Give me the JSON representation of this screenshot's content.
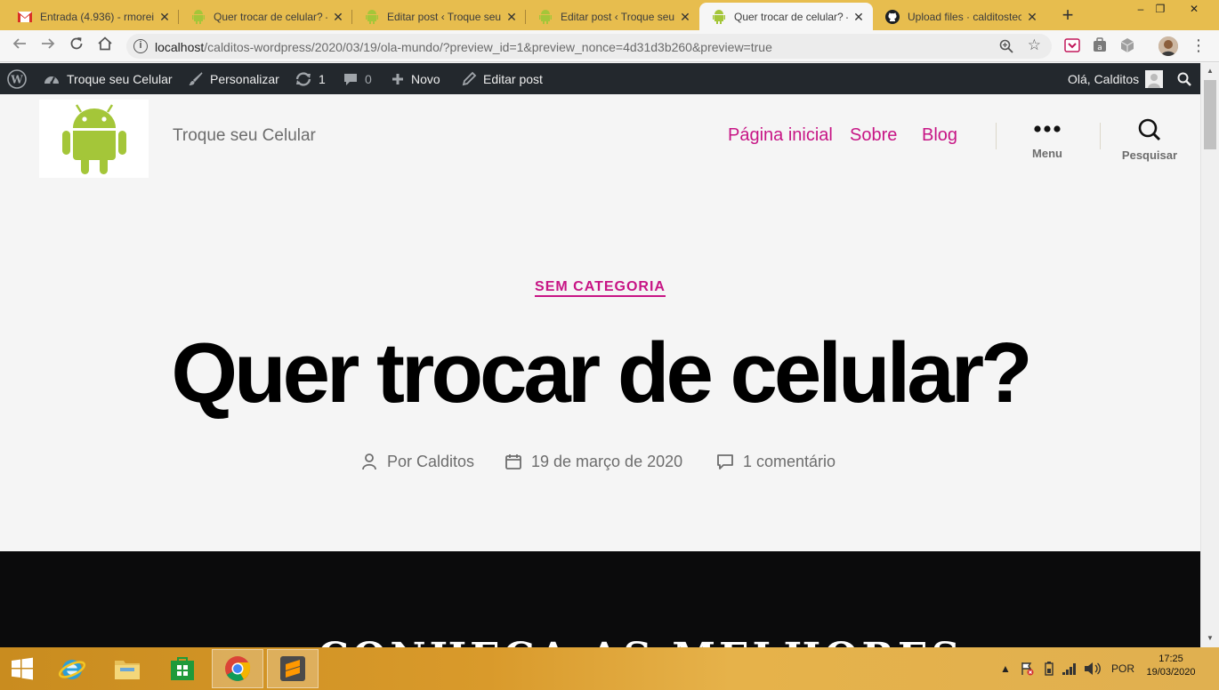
{
  "browser": {
    "tabs": [
      {
        "title": "Entrada (4.936) - rmoreir",
        "favicon": "gmail-icon",
        "active": false
      },
      {
        "title": "Quer trocar de celular? –",
        "favicon": "android-icon",
        "active": false
      },
      {
        "title": "Editar post ‹ Troque seu",
        "favicon": "android-icon",
        "active": false
      },
      {
        "title": "Editar post ‹ Troque seu",
        "favicon": "android-icon",
        "active": false
      },
      {
        "title": "Quer trocar de celular? –",
        "favicon": "android-icon",
        "active": true
      },
      {
        "title": "Upload files · calditostec",
        "favicon": "github-icon",
        "active": false
      }
    ],
    "new_tab": "+",
    "window_controls": {
      "minimize": "–",
      "maximize": "❐",
      "close": "✕"
    },
    "address": {
      "host": "localhost",
      "path": "/calditos-wordpress/2020/03/19/ola-mundo/?preview_id=1&preview_nonce=4d31d3b260&preview=true"
    }
  },
  "adminbar": {
    "site_name": "Troque seu Celular",
    "customize": "Personalizar",
    "updates_count": "1",
    "comments_count": "0",
    "new_label": "Novo",
    "edit_post": "Editar post",
    "greeting": "Olá, Calditos"
  },
  "site": {
    "title": "Troque seu Celular",
    "menu": [
      {
        "label": "Página inicial"
      },
      {
        "label": "Sobre"
      },
      {
        "label": "Blog"
      }
    ],
    "menu_toggle_label": "Menu",
    "search_toggle_label": "Pesquisar"
  },
  "post": {
    "category": "SEM CATEGORIA",
    "title": "Quer trocar de celular?",
    "author": "Por Calditos",
    "date": "19 de março de 2020",
    "comments": "1 comentário",
    "cover_text": "CONHEÇA AS MELHORES"
  },
  "taskbar": {
    "language": "POR",
    "time": "17:25",
    "date": "19/03/2020"
  },
  "colors": {
    "accent": "#c71585",
    "adminbar": "#23282d",
    "tabstrip": "#e7bd4e",
    "android_green": "#a4c639"
  }
}
